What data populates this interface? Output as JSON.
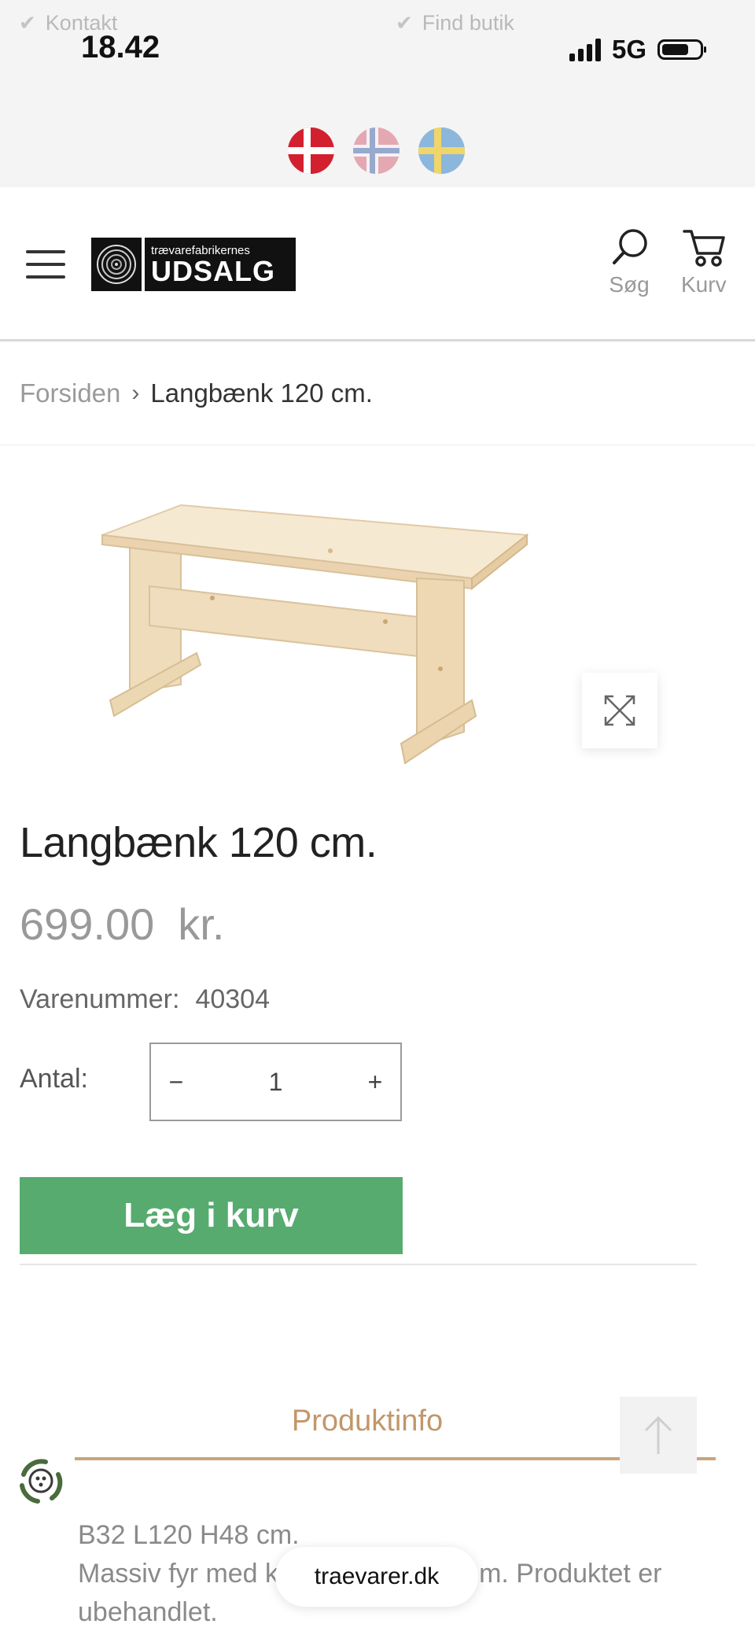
{
  "status_bar": {
    "time": "18.42",
    "network": "5G"
  },
  "usp": {
    "contact_label": "Kontakt",
    "find_store_label": "Find butik"
  },
  "languages": [
    "Danmark",
    "Norge",
    "Sverige"
  ],
  "header": {
    "logo_small": "trævarefabrikernes",
    "logo_big": "UDSALG",
    "search_label": "Søg",
    "cart_label": "Kurv"
  },
  "breadcrumb": {
    "home": "Forsiden",
    "separator": "›",
    "current": "Langbænk 120 cm."
  },
  "product": {
    "title": "Langbænk 120 cm.",
    "price": "699.00",
    "currency": "kr.",
    "sku_label": "Varenummer:",
    "sku": "40304",
    "quantity_label": "Antal:",
    "quantity": "1",
    "minus": "−",
    "plus": "+",
    "add_to_cart": "Læg i kurv"
  },
  "info": {
    "tab_label": "Produktinfo",
    "lines": [
      "B32 L120 H48 cm.",
      "Massiv fyr med k                           m. Produktet er",
      "ubehandlet."
    ]
  },
  "browser": {
    "url": "traevarer.dk"
  },
  "colors": {
    "accent_gold": "#c1976a",
    "cart_green": "#57ab6f"
  }
}
